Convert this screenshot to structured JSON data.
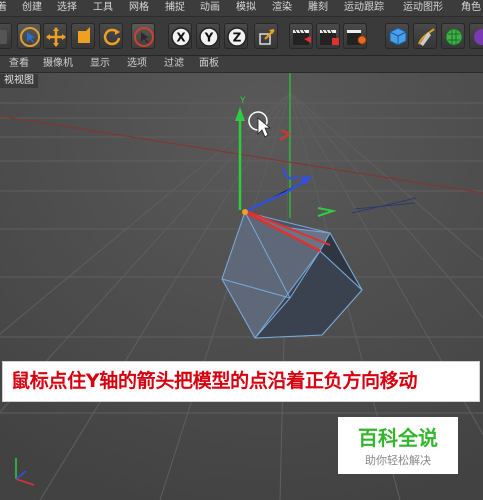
{
  "menubar": {
    "items": [
      "着",
      "创建",
      "选择",
      "工具",
      "网格",
      "捕捉",
      "动画",
      "模拟",
      "渲染",
      "雕刻",
      "运动跟踪",
      "运动图形",
      "角色"
    ]
  },
  "viewport_menu": {
    "items": [
      "查看",
      "摄像机",
      "显示",
      "选项",
      "过滤",
      "面板"
    ]
  },
  "viewport": {
    "label": "视视图",
    "axis_labels": {
      "y": "Y",
      "x": "X",
      "z": "Z"
    }
  },
  "toolbar": {
    "axis_x": "X",
    "axis_y": "Y",
    "axis_z": "Z"
  },
  "caption": {
    "text": "鼠标点住Y轴的箭头把模型的点沿着正负方向移动",
    "color": "#d7000f"
  },
  "watermark": {
    "title": "百科全说",
    "subtitle": "助你轻松解决",
    "color": "#35b52e"
  },
  "colors": {
    "background": "#4b4b4b",
    "menubar": "#3c3c3c",
    "y_axis": "#2ecc40",
    "x_axis": "#e03030",
    "z_axis": "#3050e0"
  }
}
